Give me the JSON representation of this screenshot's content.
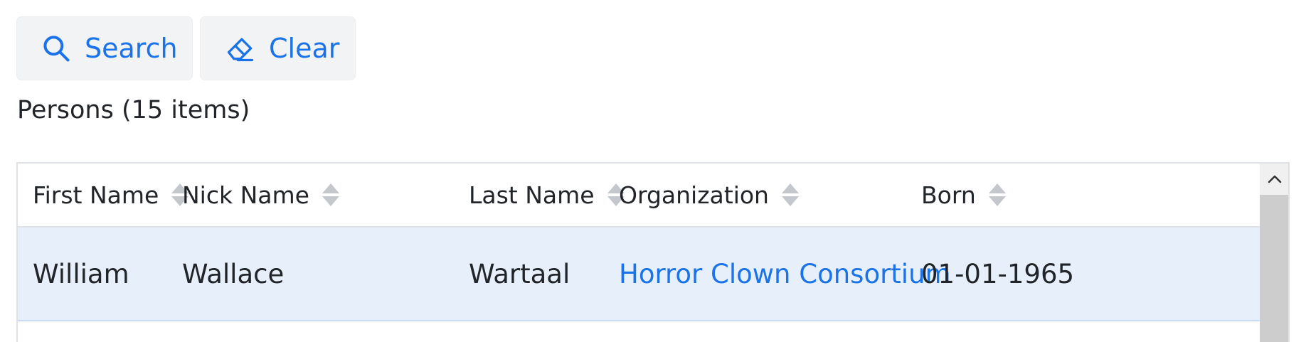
{
  "toolbar": {
    "search_label": "Search",
    "search_icon": "search-icon",
    "clear_label": "Clear",
    "clear_icon": "eraser-icon"
  },
  "grid": {
    "caption": "Persons (15 items)",
    "columns": [
      {
        "key": "first_name",
        "label": "First Name",
        "sortable": true
      },
      {
        "key": "nick_name",
        "label": "Nick Name",
        "sortable": true
      },
      {
        "key": "last_name",
        "label": "Last Name",
        "sortable": true
      },
      {
        "key": "organization",
        "label": "Organization",
        "sortable": true
      },
      {
        "key": "born",
        "label": "Born",
        "sortable": true
      }
    ],
    "rows": [
      {
        "first_name": "William",
        "nick_name": "Wallace",
        "last_name": "Wartaal",
        "organization": "Horror Clown Consortium",
        "born": "01-01-1965",
        "selected": true
      }
    ]
  },
  "colors": {
    "accent": "#1a73e8",
    "button_bg": "#f1f3f5",
    "selected_row_bg": "#e6effa",
    "text": "#212529",
    "border": "#dee2e6",
    "scrollbar_track": "#cdcdcd"
  }
}
